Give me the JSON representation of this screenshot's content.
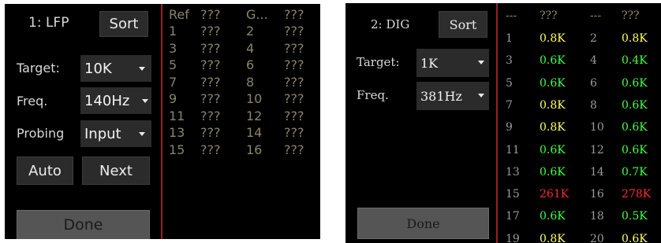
{
  "panel1": {
    "title": "1: LFP",
    "sort_label": "Sort",
    "target_label": "Target:",
    "target_value": "10K",
    "freq_label": "Freq.",
    "freq_value": "140Hz",
    "probing_label": "Probing",
    "probing_value": "Input",
    "auto_label": "Auto",
    "next_label": "Next",
    "done_label": "Done",
    "headers": [
      "Ref",
      "???",
      "G...",
      "???"
    ],
    "rows": [
      [
        "1",
        "???",
        "2",
        "???"
      ],
      [
        "3",
        "???",
        "4",
        "???"
      ],
      [
        "5",
        "???",
        "6",
        "???"
      ],
      [
        "7",
        "???",
        "8",
        "???"
      ],
      [
        "9",
        "???",
        "10",
        "???"
      ],
      [
        "11",
        "???",
        "12",
        "???"
      ],
      [
        "13",
        "???",
        "14",
        "???"
      ],
      [
        "15",
        "???",
        "16",
        "???"
      ]
    ]
  },
  "panel2": {
    "title": "2: DIG",
    "sort_label": "Sort",
    "target_label": "Target:",
    "target_value": "1K",
    "freq_label": "Freq.",
    "freq_value": "381Hz",
    "done_label": "Done",
    "headers": [
      "---",
      "???",
      "---",
      "???"
    ],
    "rows": [
      [
        "1",
        "0.8K",
        "2",
        "0.8K"
      ],
      [
        "3",
        "0.6K",
        "4",
        "0.4K"
      ],
      [
        "5",
        "0.6K",
        "6",
        "0.6K"
      ],
      [
        "7",
        "0.8K",
        "8",
        "0.6K"
      ],
      [
        "9",
        "0.8K",
        "10",
        "0.6K"
      ],
      [
        "11",
        "0.6K",
        "12",
        "0.6K"
      ],
      [
        "13",
        "0.6K",
        "14",
        "0.7K"
      ],
      [
        "15",
        "261K",
        "16",
        "278K"
      ],
      [
        "17",
        "0.6K",
        "18",
        "0.5K"
      ],
      [
        "19",
        "0.8K",
        "20",
        "0.6K"
      ]
    ],
    "value_colors": [
      [
        "#ffff66",
        "#ffff66"
      ],
      [
        "#44ff44",
        "#44ff44"
      ],
      [
        "#44ff44",
        "#44ff44"
      ],
      [
        "#ffff66",
        "#44ff44"
      ],
      [
        "#ffff66",
        "#44ff44"
      ],
      [
        "#44ff44",
        "#44ff44"
      ],
      [
        "#44ff44",
        "#44ff44"
      ],
      [
        "#ff2a2a",
        "#ff2a2a"
      ],
      [
        "#44ff44",
        "#44ff44"
      ],
      [
        "#ffff66",
        "#ffff66"
      ]
    ]
  },
  "colors": {
    "background": "#000000",
    "divider": "#9a1f1f",
    "button_bg": "#2b2b2b",
    "done_bg": "#555555"
  }
}
